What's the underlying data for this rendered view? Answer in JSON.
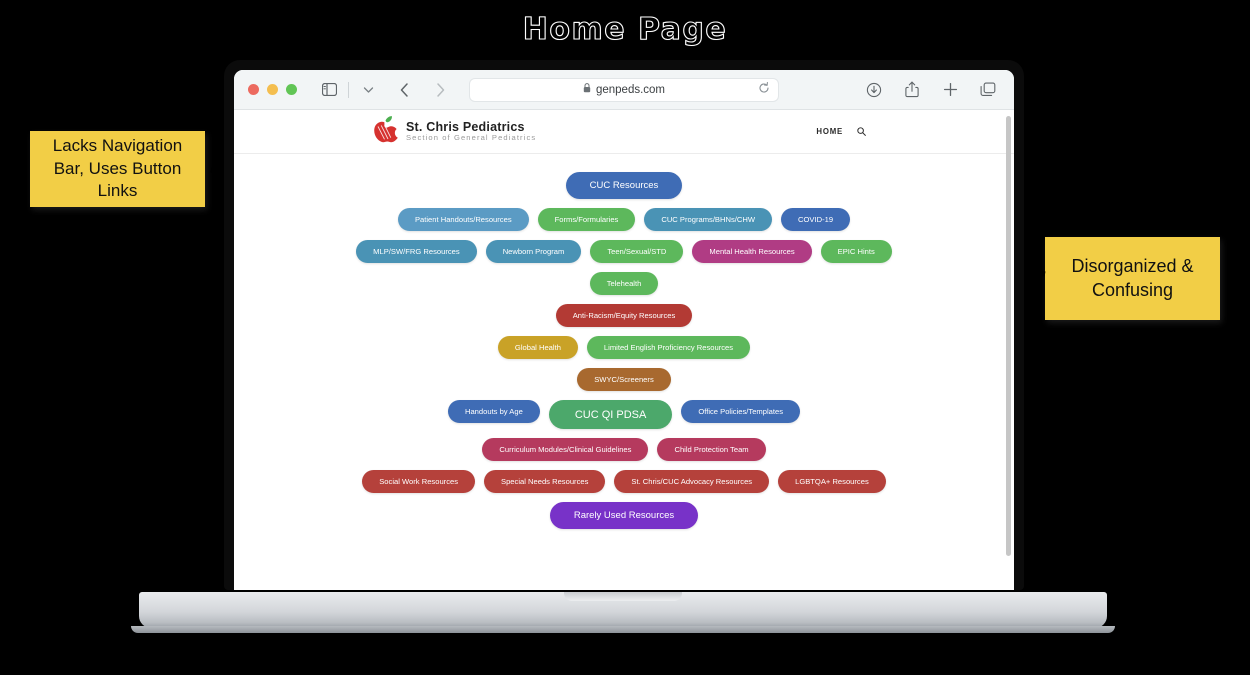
{
  "slide": {
    "title": "Home Page"
  },
  "annotations": [
    {
      "id": "left",
      "text": "Lacks Navigation Bar, Uses Button Links"
    },
    {
      "id": "right",
      "text": "Disorganized & Confusing"
    }
  ],
  "browser": {
    "url": "genpeds.com",
    "traffic_lights": [
      "close-red",
      "minimize-yellow",
      "maximize-green"
    ],
    "toolbar_icons_left": [
      "sidebar-toggle-icon",
      "chevron-down-icon",
      "back-arrow-icon",
      "forward-arrow-icon"
    ],
    "toolbar_icons_right": [
      "download-icon",
      "share-icon",
      "new-tab-plus-icon",
      "tab-overview-icon"
    ],
    "reload_icon": "reload-icon",
    "lock_icon": "lock-icon"
  },
  "site": {
    "brand_title": "St. Chris Pediatrics",
    "brand_subtitle": "Section of General Pediatrics",
    "logo_icon": "apple-logo-icon",
    "nav_home": "HOME",
    "search_icon": "search-icon"
  },
  "colors": {
    "royal_blue": "#3F6CB5",
    "light_blue": "#5B9BC4",
    "teal_blue": "#4A93B5",
    "green": "#5DB85C",
    "sea_green": "#4CA86B",
    "magenta": "#B03C84",
    "dark_red": "#B33A34",
    "brick_red": "#B5413B",
    "crimson": "#B53A5E",
    "gold": "#C9A227",
    "brown": "#A8692F",
    "purple": "#7832C8",
    "note_yellow": "#F2CE46"
  },
  "button_rows": [
    {
      "row": 1,
      "buttons": [
        {
          "label": "CUC Resources",
          "color": "#3F6CB5",
          "size": "lg"
        }
      ]
    },
    {
      "row": 2,
      "buttons": [
        {
          "label": "Patient Handouts/Resources",
          "color": "#5B9BC4",
          "size": "md"
        },
        {
          "label": "Forms/Formularies",
          "color": "#5DB85C",
          "size": "md"
        },
        {
          "label": "CUC Programs/BHNs/CHW",
          "color": "#4A93B5",
          "size": "md"
        },
        {
          "label": "COVID-19",
          "color": "#3F6CB5",
          "size": "md"
        }
      ]
    },
    {
      "row": 3,
      "buttons": [
        {
          "label": "MLP/SW/FRG Resources",
          "color": "#4A93B5",
          "size": "md"
        },
        {
          "label": "Newborn Program",
          "color": "#4A93B5",
          "size": "md"
        },
        {
          "label": "Teen/Sexual/STD",
          "color": "#5DB85C",
          "size": "md"
        },
        {
          "label": "Mental Health Resources",
          "color": "#B03C84",
          "size": "md"
        },
        {
          "label": "EPIC Hints",
          "color": "#5DB85C",
          "size": "md"
        }
      ]
    },
    {
      "row": 4,
      "buttons": [
        {
          "label": "Telehealth",
          "color": "#5DB85C",
          "size": "md"
        }
      ]
    },
    {
      "row": 5,
      "buttons": [
        {
          "label": "Anti-Racism/Equity Resources",
          "color": "#B33A34",
          "size": "md"
        }
      ]
    },
    {
      "row": 6,
      "buttons": [
        {
          "label": "Global Health",
          "color": "#C9A227",
          "size": "md"
        },
        {
          "label": "Limited English Proficiency Resources",
          "color": "#5DB85C",
          "size": "md"
        }
      ]
    },
    {
      "row": 7,
      "buttons": [
        {
          "label": "SWYC/Screeners",
          "color": "#A8692F",
          "size": "md"
        }
      ]
    },
    {
      "row": 8,
      "buttons": [
        {
          "label": "Handouts by Age",
          "color": "#3F6CB5",
          "size": "md"
        },
        {
          "label": "CUC QI PDSA",
          "color": "#4CA86B",
          "size": "xl"
        },
        {
          "label": "Office Policies/Templates",
          "color": "#3F6CB5",
          "size": "md"
        }
      ]
    },
    {
      "row": 9,
      "buttons": [
        {
          "label": "Curriculum Modules/Clinical Guidelines",
          "color": "#B53A5E",
          "size": "md"
        },
        {
          "label": "Child Protection Team",
          "color": "#B53A5E",
          "size": "md"
        }
      ]
    },
    {
      "row": 10,
      "buttons": [
        {
          "label": "Social Work Resources",
          "color": "#B5413B",
          "size": "md"
        },
        {
          "label": "Special Needs Resources",
          "color": "#B5413B",
          "size": "md"
        },
        {
          "label": "St. Chris/CUC Advocacy Resources",
          "color": "#B5413B",
          "size": "md"
        },
        {
          "label": "LGBTQA+ Resources",
          "color": "#B5413B",
          "size": "md"
        }
      ]
    },
    {
      "row": 11,
      "buttons": [
        {
          "label": "Rarely Used Resources",
          "color": "#7832C8",
          "size": "lg"
        }
      ]
    }
  ]
}
